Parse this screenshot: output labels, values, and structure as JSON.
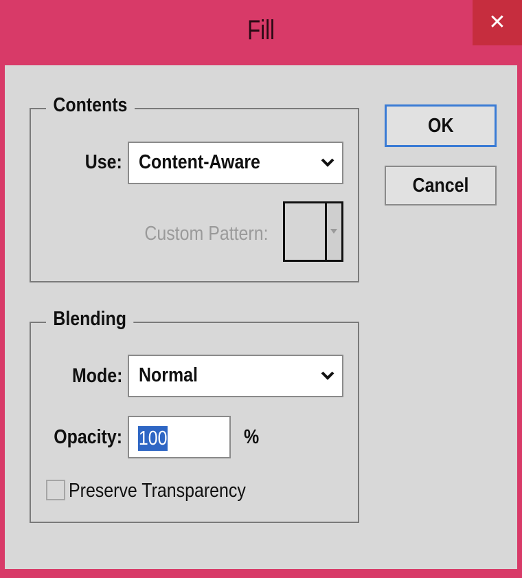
{
  "window": {
    "title": "Fill",
    "close_glyph": "✕"
  },
  "buttons": {
    "ok": "OK",
    "cancel": "Cancel"
  },
  "contents": {
    "legend": "Contents",
    "use_label": "Use:",
    "use_value": "Content-Aware",
    "custom_pattern_label": "Custom Pattern:"
  },
  "blending": {
    "legend": "Blending",
    "mode_label": "Mode:",
    "mode_value": "Normal",
    "opacity_label": "Opacity:",
    "opacity_value": "100",
    "opacity_unit": "%",
    "preserve_label": "Preserve Transparency",
    "preserve_checked": false
  },
  "colors": {
    "titlebar": "#d83a68",
    "close_button": "#c62d3e",
    "dialog_bg": "#d8d8d8",
    "selection": "#2e66c4",
    "default_button_border": "#3a7bd5"
  },
  "icons": {
    "close": "close-icon",
    "dropdown": "chevron-down-icon",
    "pattern_dropdown": "triangle-down-icon"
  }
}
